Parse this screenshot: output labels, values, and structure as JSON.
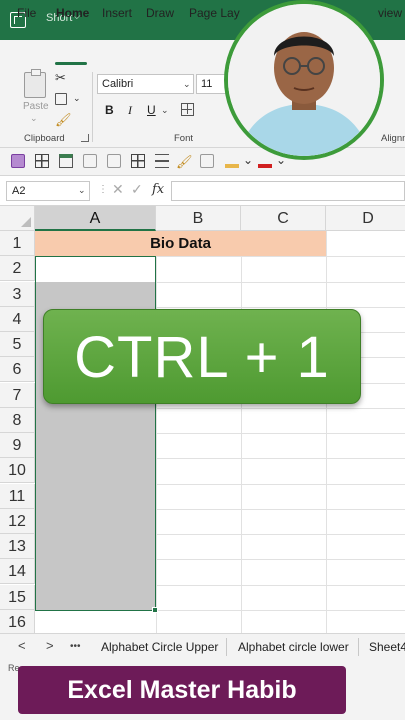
{
  "titlebar": {
    "file_name": "Short",
    "chevron": "⌵",
    "app_icon": "excel-icon",
    "accent_color": "#217346"
  },
  "menu": {
    "tabs": [
      "File",
      "Home",
      "Insert",
      "Draw",
      "Page Lay",
      "view"
    ],
    "active": "Home"
  },
  "ribbon": {
    "paste_label": "Paste",
    "clipboard_label": "Clipboard",
    "font_label": "Font",
    "alignment_label": "Alignm",
    "font_name": "Calibri",
    "font_size": "11",
    "bold": "B",
    "italic": "I",
    "underline": "U",
    "chev": "⌄"
  },
  "formula_bar": {
    "name_box": "A2",
    "fx_label": "fx",
    "cancel": "✕",
    "enter": "✓",
    "dots": "⋮",
    "value": ""
  },
  "grid": {
    "columns": [
      "A",
      "B",
      "C",
      "D"
    ],
    "rows": [
      "1",
      "2",
      "3",
      "4",
      "5",
      "6",
      "7",
      "8",
      "9",
      "10",
      "11",
      "12",
      "13",
      "14",
      "15",
      "16"
    ],
    "title_cell_text": "Bio Data",
    "title_fill_color": "#f8cbad",
    "selection_color": "#c6c6c6"
  },
  "overlay": {
    "shortcut_text": "CTRL + 1",
    "badge_color": "#5aa63b"
  },
  "sheet_tabs": {
    "prev": "<",
    "next": ">",
    "more": "•••",
    "tabs": [
      "Alphabet Circle Upper",
      "Alphabet circle lower",
      "Sheet4"
    ]
  },
  "status_bar": {
    "text": "Re"
  },
  "banner": {
    "text": "Excel Master Habib",
    "color": "#6d1b58"
  },
  "avatar": {
    "name": "presenter-avatar",
    "border_color": "#3d9b3a"
  }
}
